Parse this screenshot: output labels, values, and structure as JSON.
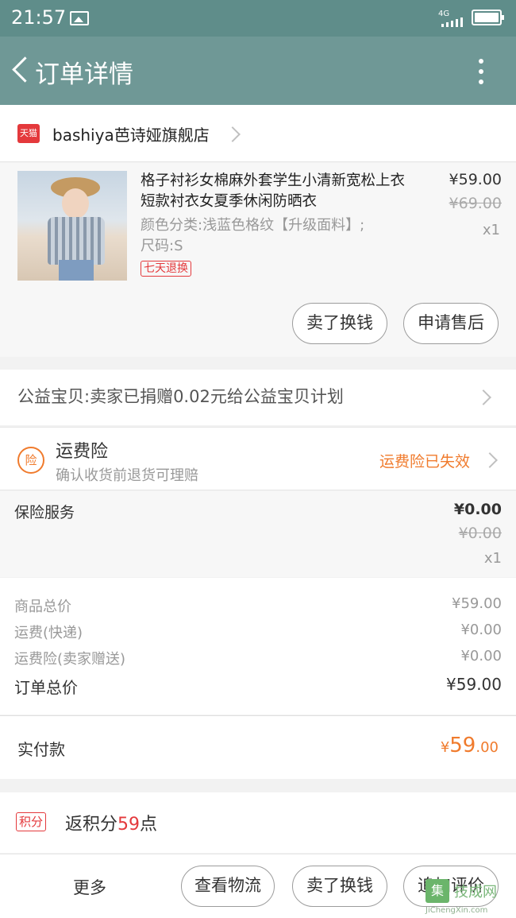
{
  "statusbar": {
    "time": "21:57",
    "network": "4G"
  },
  "header": {
    "title": "订单详情"
  },
  "shop": {
    "badge": "天猫",
    "name": "bashiya芭诗娅旗舰店"
  },
  "product": {
    "title": "格子衬衫女棉麻外套学生小清新宽松上衣短款衬衣女夏季休闲防晒衣",
    "variant": "颜色分类:浅蓝色格纹【升级面料】;尺码:S",
    "badge": "七天退换",
    "price": "¥59.00",
    "original_price": "¥69.00",
    "quantity": "x1",
    "actions": [
      "卖了换钱",
      "申请售后"
    ]
  },
  "charity": {
    "text": "公益宝贝:卖家已捐赠0.02元给公益宝贝计划"
  },
  "insurance": {
    "icon_char": "险",
    "title": "运费险",
    "subtitle": "确认收货前退货可理赔",
    "status": "运费险已失效",
    "status_color": "#f07b2d"
  },
  "service": {
    "label": "保险服务",
    "price": "¥0.00",
    "original_price": "¥0.00",
    "quantity": "x1"
  },
  "summary": {
    "rows": [
      {
        "label": "商品总价",
        "value": "¥59.00"
      },
      {
        "label": "运费(快递)",
        "value": "¥0.00"
      },
      {
        "label": "运费险(卖家赠送)",
        "value": "¥0.00"
      }
    ],
    "total_label": "订单总价",
    "total_value": "¥59.00"
  },
  "paid": {
    "label": "实付款",
    "currency": "¥",
    "integer": "59",
    "decimal": ".00",
    "color": "#f07b2d"
  },
  "points": {
    "tag": "积分",
    "prefix": "返积分",
    "value": "59",
    "suffix": "点"
  },
  "bottom": {
    "more": "更多",
    "buttons": [
      "查看物流",
      "卖了换钱",
      "追加评价"
    ]
  },
  "watermark": {
    "mark": "集",
    "name": "技成网",
    "url": "JiChengXin.com"
  }
}
